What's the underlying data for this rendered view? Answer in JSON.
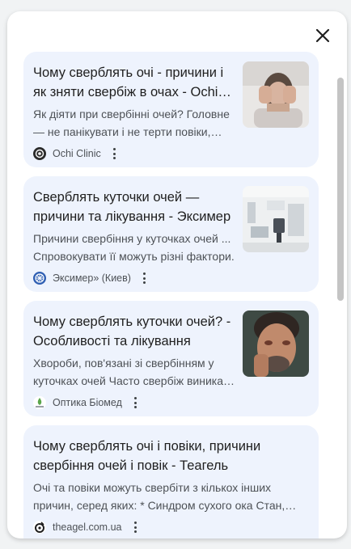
{
  "dialog": {
    "close_icon": "close-icon",
    "results": [
      {
        "title": "Чому сверблять очі - причини і як зняти свербіж в очах - Ochi Clinic",
        "snippet": "Як діяти при свербінні очей? Головне — не панікувати і не терти повіки, щоб не спровокувати ще більше подразнення.",
        "source": "Ochi Clinic",
        "has_thumbnail": true
      },
      {
        "title": "Сверблять куточки очей — причини та лікування - Эксимер",
        "snippet": "Причини свербіння у куточках очей ... Спровокувати її можуть різні фактори.",
        "source": "Эксимер» (Киев)",
        "has_thumbnail": true
      },
      {
        "title": "Чому сверблять куточки очей? - Особливості та лікування",
        "snippet": "Хвороби, пов'язані зі свербінням у куточках очей Часто свербіж виникає внаслідок захворювань.",
        "source": "Оптика Біомед",
        "has_thumbnail": true
      },
      {
        "title": "Чому сверблять очі і повіки, причини свербіння очей і повік - Теагель",
        "snippet": "Очі та повіки можуть свербіти з кількох інших причин, серед яких: * Синдром сухого ока Стан, при якому",
        "source": "theagel.com.ua",
        "has_thumbnail": false
      }
    ]
  },
  "colors": {
    "card_bg": "#eef3fd",
    "title": "#1f1f1f",
    "snippet": "#4d5156"
  }
}
